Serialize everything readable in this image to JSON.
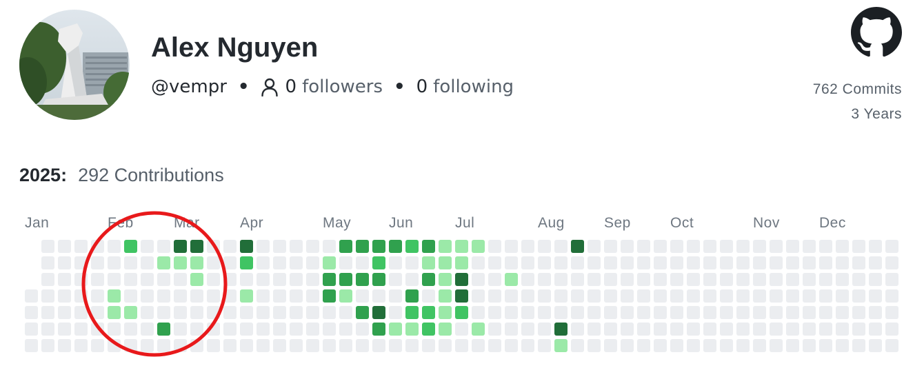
{
  "profile": {
    "name": "Alex Nguyen",
    "handle": "@vempr",
    "followers_count": "0",
    "followers_label": "followers",
    "following_count": "0",
    "following_label": "following",
    "separator": "•"
  },
  "icons": {
    "person": "person-icon",
    "github": "github-logo-icon",
    "avatar": "profile-photo"
  },
  "stats": {
    "commits": "762 Commits",
    "years": "3 Years"
  },
  "contributions": {
    "year": "2025:",
    "summary": "292 Contributions",
    "months": [
      "Jan",
      "Feb",
      "Mar",
      "Apr",
      "May",
      "Jun",
      "Jul",
      "Aug",
      "Sep",
      "Oct",
      "Nov",
      "Dec"
    ],
    "month_start_weeks": [
      0,
      5,
      9,
      13,
      18,
      22,
      26,
      31,
      35,
      39,
      44,
      48
    ],
    "week_count": 53,
    "first_week_start_day": 3,
    "last_week_end_day": 6,
    "colors": [
      "#ebedf0",
      "#9be9a8",
      "#40c463",
      "#30a14e",
      "#216e39"
    ],
    "active_cells": [
      [
        5,
        3,
        1
      ],
      [
        5,
        4,
        1
      ],
      [
        6,
        0,
        2
      ],
      [
        6,
        4,
        1
      ],
      [
        8,
        1,
        1
      ],
      [
        8,
        5,
        3
      ],
      [
        9,
        0,
        4
      ],
      [
        9,
        1,
        1
      ],
      [
        10,
        0,
        4
      ],
      [
        10,
        1,
        1
      ],
      [
        10,
        2,
        1
      ],
      [
        13,
        0,
        4
      ],
      [
        13,
        1,
        2
      ],
      [
        13,
        3,
        1
      ],
      [
        18,
        1,
        1
      ],
      [
        18,
        2,
        3
      ],
      [
        18,
        3,
        3
      ],
      [
        19,
        0,
        3
      ],
      [
        19,
        2,
        3
      ],
      [
        19,
        3,
        1
      ],
      [
        20,
        0,
        3
      ],
      [
        20,
        2,
        3
      ],
      [
        20,
        4,
        3
      ],
      [
        21,
        0,
        3
      ],
      [
        21,
        1,
        2
      ],
      [
        21,
        2,
        3
      ],
      [
        21,
        4,
        4
      ],
      [
        21,
        5,
        3
      ],
      [
        22,
        0,
        3
      ],
      [
        22,
        5,
        1
      ],
      [
        23,
        0,
        2
      ],
      [
        23,
        3,
        3
      ],
      [
        23,
        4,
        2
      ],
      [
        23,
        5,
        1
      ],
      [
        24,
        0,
        3
      ],
      [
        24,
        1,
        1
      ],
      [
        24,
        2,
        3
      ],
      [
        24,
        4,
        2
      ],
      [
        24,
        5,
        2
      ],
      [
        25,
        0,
        1
      ],
      [
        25,
        1,
        1
      ],
      [
        25,
        2,
        1
      ],
      [
        25,
        3,
        1
      ],
      [
        25,
        4,
        1
      ],
      [
        25,
        5,
        1
      ],
      [
        26,
        0,
        1
      ],
      [
        26,
        1,
        1
      ],
      [
        26,
        2,
        4
      ],
      [
        26,
        3,
        4
      ],
      [
        26,
        4,
        2
      ],
      [
        27,
        0,
        1
      ],
      [
        27,
        5,
        1
      ],
      [
        29,
        2,
        1
      ],
      [
        32,
        5,
        4
      ],
      [
        32,
        6,
        1
      ],
      [
        33,
        0,
        4
      ]
    ],
    "annotation": {
      "shape": "circle",
      "color": "#e8191b"
    }
  }
}
